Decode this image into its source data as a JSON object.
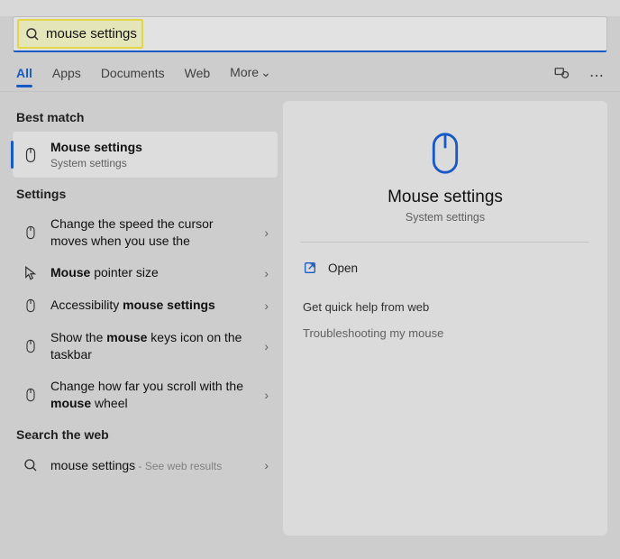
{
  "search": {
    "query": "mouse settings"
  },
  "tabs": {
    "all": "All",
    "apps": "Apps",
    "documents": "Documents",
    "web": "Web",
    "more": "More"
  },
  "left": {
    "best_match_label": "Best match",
    "best": {
      "title": "Mouse settings",
      "sub": "System settings"
    },
    "settings_label": "Settings",
    "settings": [
      {
        "title_pre": "Change the speed the cursor moves when you use the",
        "title_bold": ""
      },
      {
        "title_pre": "",
        "title_bold": "Mouse",
        "title_post": " pointer size"
      },
      {
        "title_pre": "Accessibility ",
        "title_bold": "mouse settings",
        "title_post": ""
      },
      {
        "title_pre": "Show the ",
        "title_bold": "mouse",
        "title_post": " keys icon on the taskbar"
      },
      {
        "title_pre": "Change how far you scroll with the ",
        "title_bold": "mouse",
        "title_post": " wheel"
      }
    ],
    "web_label": "Search the web",
    "web": {
      "title": "mouse settings",
      "suffix": " - See web results"
    }
  },
  "right": {
    "title": "Mouse settings",
    "sub": "System settings",
    "open": "Open",
    "help_label": "Get quick help from web",
    "links": [
      "Troubleshooting my mouse"
    ]
  }
}
